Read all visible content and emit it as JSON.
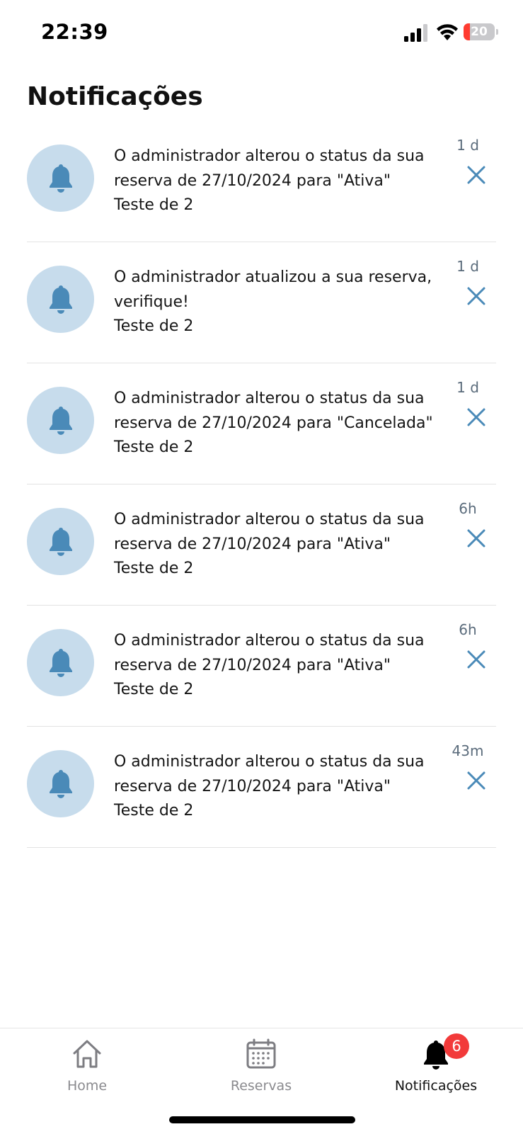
{
  "status_bar": {
    "time": "22:39",
    "battery_level": "20"
  },
  "page": {
    "title": "Notificações"
  },
  "notifications": [
    {
      "message": "O administrador alterou o status da sua reserva de 27/10/2024 para \"Ativa\"",
      "subtitle": "Teste de 2",
      "time": "1 d"
    },
    {
      "message": "O administrador atualizou a sua reserva, verifique!",
      "subtitle": "Teste de 2",
      "time": "1 d"
    },
    {
      "message": "O administrador alterou o status da sua reserva de 27/10/2024 para \"Cancelada\"",
      "subtitle": "Teste de 2",
      "time": "1 d"
    },
    {
      "message": "O administrador alterou o status da sua reserva de 27/10/2024 para \"Ativa\"",
      "subtitle": "Teste de 2",
      "time": "6h"
    },
    {
      "message": "O administrador alterou o status da sua reserva de 27/10/2024 para \"Ativa\"",
      "subtitle": "Teste de 2",
      "time": "6h"
    },
    {
      "message": "O administrador alterou o status da sua reserva de 27/10/2024 para \"Ativa\"",
      "subtitle": "Teste de 2",
      "time": "43m"
    }
  ],
  "tab_bar": {
    "tabs": [
      {
        "label": "Home",
        "icon": "home-icon"
      },
      {
        "label": "Reservas",
        "icon": "calendar-icon"
      },
      {
        "label": "Notificações",
        "icon": "bell-icon",
        "badge": "6"
      }
    ]
  },
  "colors": {
    "accent": "#4a8ab8",
    "avatar_bg": "#c7dcec",
    "badge": "#f23a3a",
    "battery_low": "#ff3b30"
  }
}
